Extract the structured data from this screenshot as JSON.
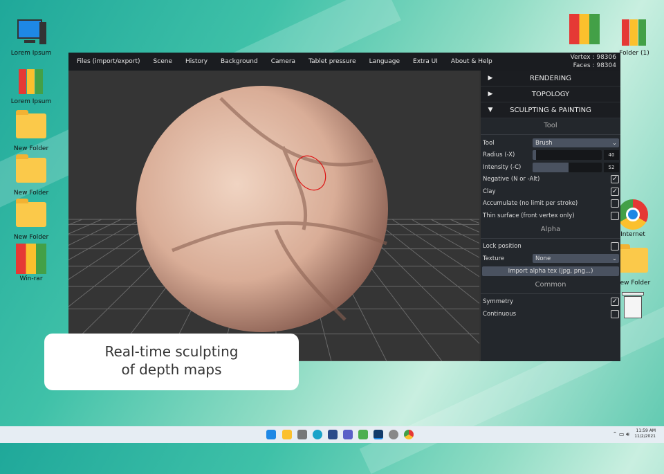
{
  "desktop": {
    "left_icons": [
      {
        "label": "Lorem Ipsum",
        "icon": "computer-icon"
      },
      {
        "label": "Lorem Ipsum",
        "icon": "archive-icon"
      },
      {
        "label": "New Folder",
        "icon": "folder-icon"
      },
      {
        "label": "New Folder",
        "icon": "folder-icon"
      },
      {
        "label": "New Folder",
        "icon": "folder-icon"
      },
      {
        "label": "Win-rar",
        "icon": "winrar-icon"
      }
    ],
    "right_icons": [
      {
        "label": "",
        "icon": "winrar-icon"
      },
      {
        "label": "Folder (1)",
        "icon": "archive-icon"
      },
      {
        "label": "Internet",
        "icon": "chrome-icon"
      },
      {
        "label": "New Folder",
        "icon": "folder-icon"
      },
      {
        "label": "",
        "icon": "trash-icon"
      }
    ]
  },
  "app": {
    "menu": [
      "Files (import/export)",
      "Scene",
      "History",
      "Background",
      "Camera",
      "Tablet pressure",
      "Language",
      "Extra UI",
      "About & Help"
    ],
    "vertex": "Vertex : 98306",
    "faces": "Faces : 98304",
    "sections": {
      "rendering": "RENDERING",
      "topology": "TOPOLOGY",
      "sculpting": "SCULPTING & PAINTING"
    },
    "tool_header": "Tool",
    "tool_label": "Tool",
    "tool_value": "Brush",
    "radius_label": "Radius (-X)",
    "radius_value": "40",
    "radius_fraction": 0.04,
    "intensity_label": "Intensity (-C)",
    "intensity_value": "52",
    "intensity_fraction": 0.52,
    "negative": "Negative (N or -Alt)",
    "clay": "Clay",
    "accumulate": "Accumulate (no limit per stroke)",
    "thin": "Thin surface (front vertex only)",
    "alpha_header": "Alpha",
    "lock": "Lock position",
    "texture_label": "Texture",
    "texture_value": "None",
    "import_alpha": "Import alpha tex (jpg, png...)",
    "common_header": "Common",
    "symmetry": "Symmetry",
    "continuous": "Continuous",
    "check": "✓"
  },
  "caption": {
    "line1": "Real-time sculpting",
    "line2": "of depth maps"
  },
  "taskbar": {
    "time": "11:59 AM",
    "date": "11/2/2021"
  }
}
